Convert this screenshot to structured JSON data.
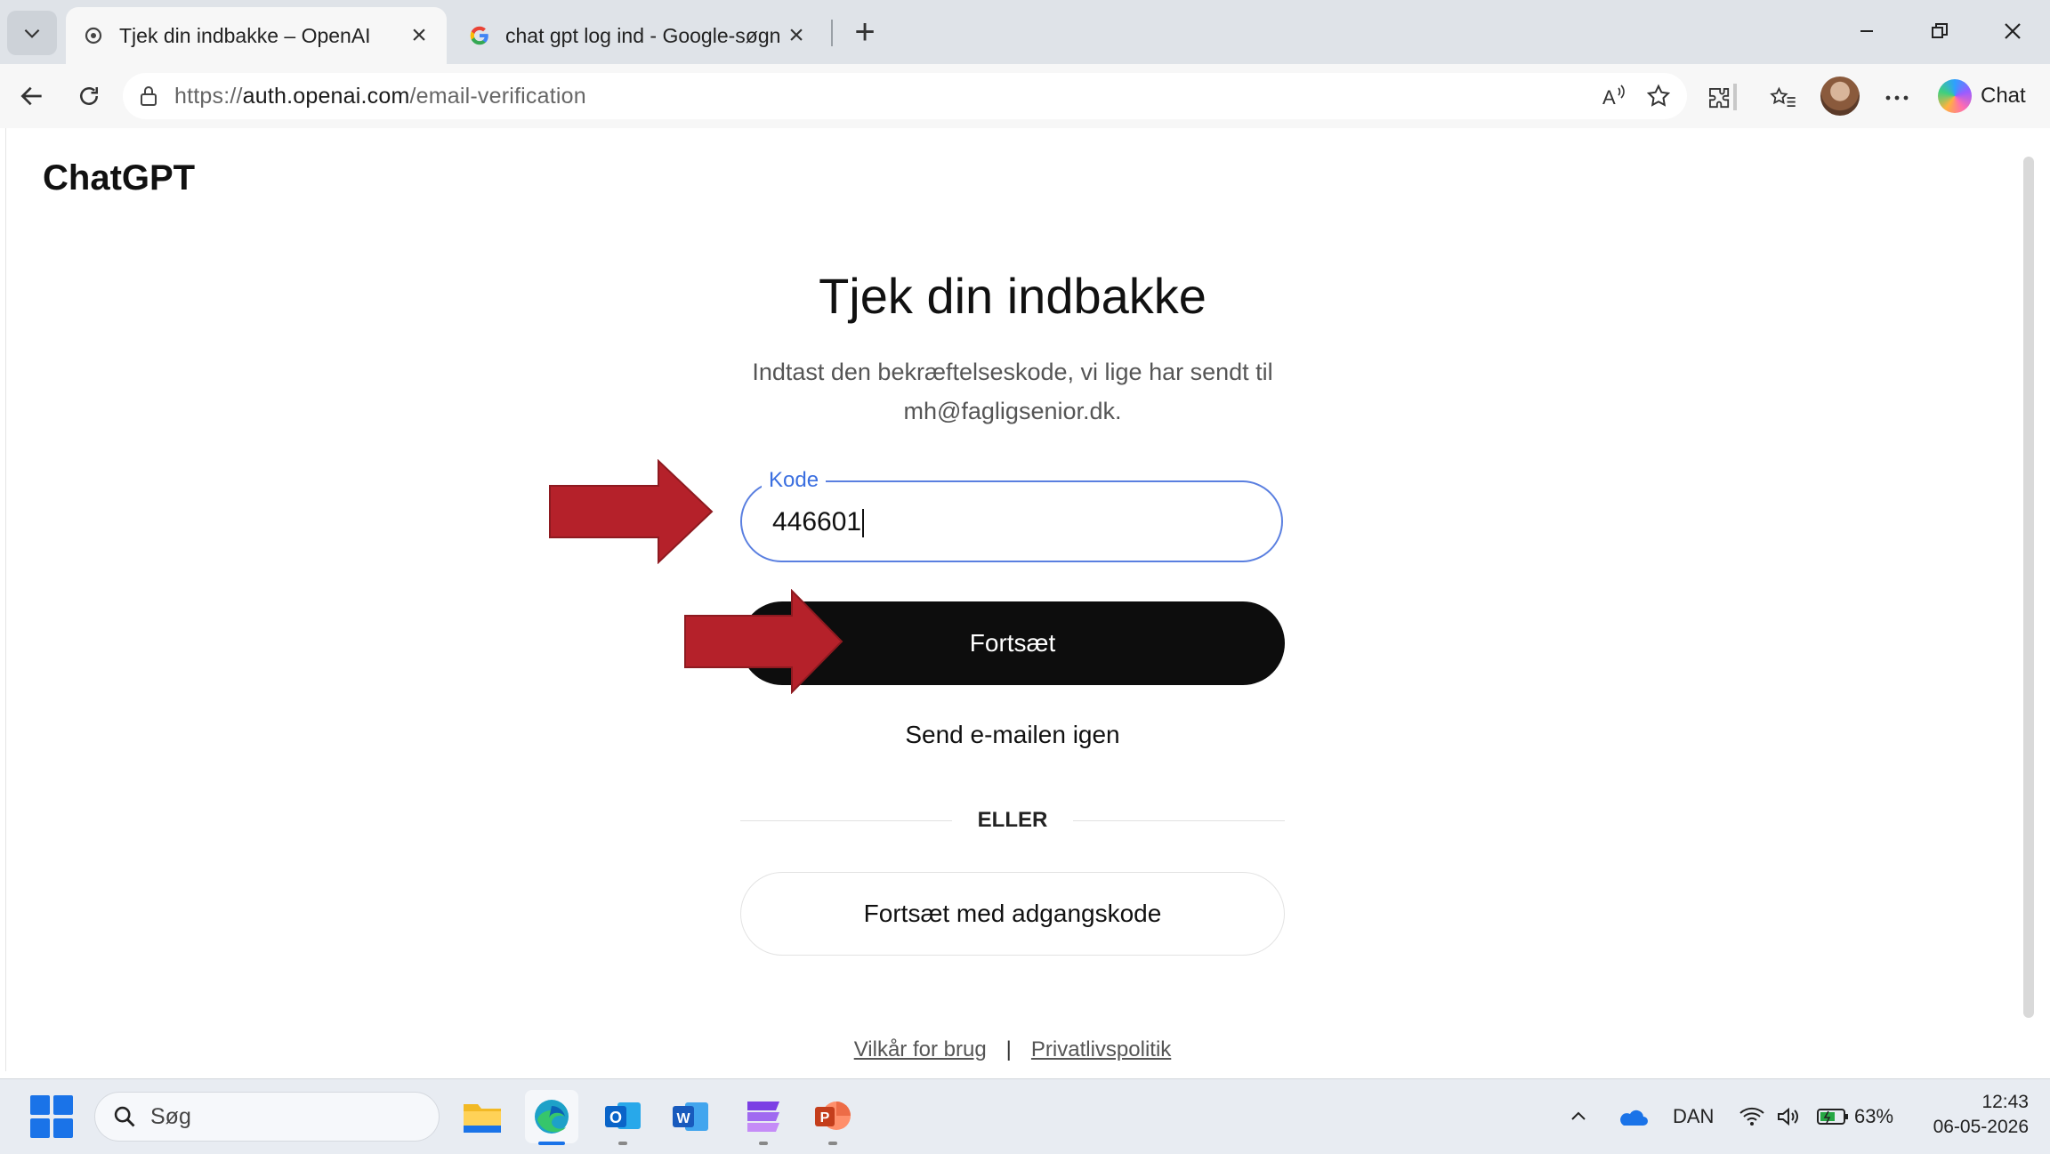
{
  "browser": {
    "tabs": [
      {
        "title": "Tjek din indbakke – OpenAI",
        "active": true,
        "favicon": "openai-icon"
      },
      {
        "title": "chat gpt log ind - Google-søgning",
        "active": false,
        "favicon": "google-icon"
      }
    ],
    "url_prefix": "https://",
    "url_host": "auth.openai.com",
    "url_path": "/email-verification",
    "copilot_label": "Chat"
  },
  "page": {
    "brand": "ChatGPT",
    "heading": "Tjek din indbakke",
    "subtitle": "Indtast den bekræftelseskode, vi lige har sendt til mh@fagligsenior.dk.",
    "code_label": "Kode",
    "code_value": "446601",
    "continue_label": "Fortsæt",
    "resend_label": "Send e-mailen igen",
    "divider_label": "ELLER",
    "password_label": "Fortsæt med adgangskode",
    "terms_label": "Vilkår for brug",
    "footer_separator": "|",
    "privacy_label": "Privatlivspolitik"
  },
  "taskbar": {
    "search_placeholder": "Søg",
    "language": "DAN",
    "battery": "63%",
    "time": "12:43",
    "date": "06-05-2026"
  },
  "colors": {
    "accent": "#3b6fe0",
    "button_dark": "#0d0d0d",
    "annotation_arrow": "#b5212a"
  }
}
